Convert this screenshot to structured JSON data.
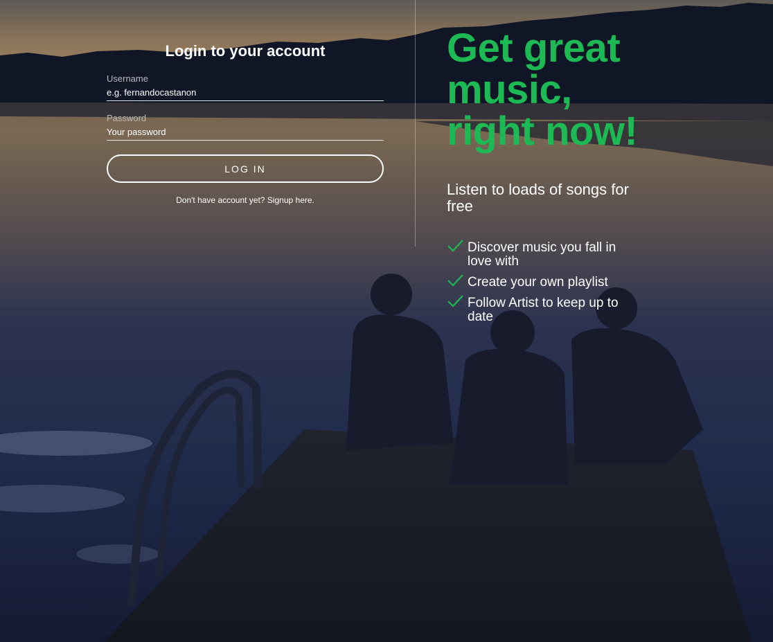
{
  "login": {
    "title": "Login to your account",
    "username_label": "Username",
    "username_placeholder": "e.g. fernandocastanon",
    "password_label": "Password",
    "password_placeholder": "Your password",
    "button_label": "LOG IN",
    "signup_text": "Don't have account yet? Signup here."
  },
  "promo": {
    "headline": "Get great music, right now!",
    "subheadline": "Listen to loads of songs for free",
    "features": [
      "Discover music you fall in love with",
      "Create your own playlist",
      "Follow Artist to keep up to date"
    ]
  },
  "colors": {
    "accent": "#1db954",
    "text": "#ffffff"
  },
  "icons": {
    "feature_bullet": "check-icon"
  }
}
